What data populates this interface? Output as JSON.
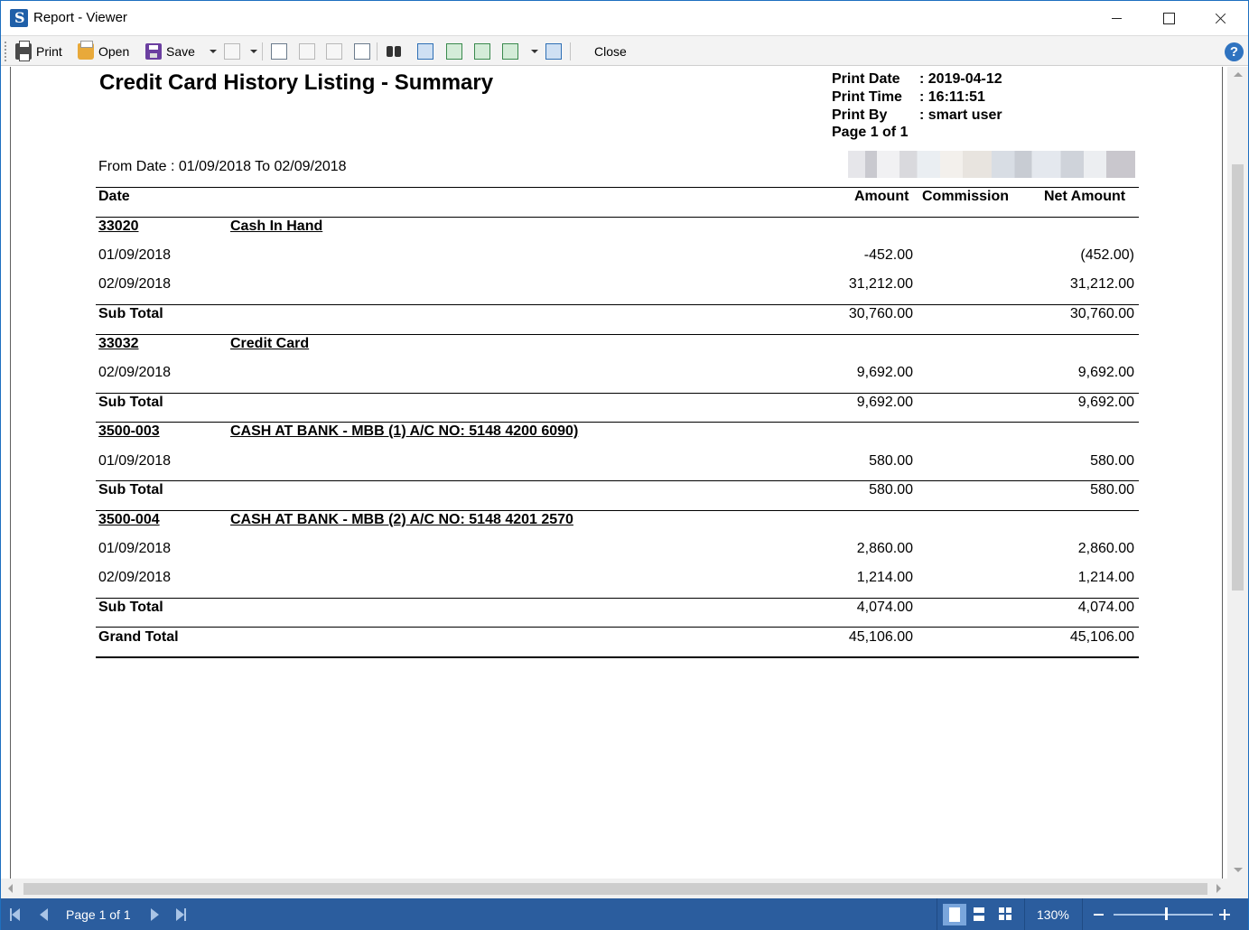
{
  "window": {
    "title": "Report - Viewer"
  },
  "toolbar": {
    "print_label": "Print",
    "open_label": "Open",
    "save_label": "Save",
    "close_label": "Close",
    "help_label": "?"
  },
  "report": {
    "title": "Credit Card History Listing - Summary",
    "meta": {
      "print_date_label": "Print Date",
      "print_date_value": ": 2019-04-12",
      "print_time_label": "Print Time",
      "print_time_value": ": 16:11:51",
      "print_by_label": "Print By",
      "print_by_value": ": smart user",
      "page_label": "Page 1 of 1"
    },
    "date_range": "From Date : 01/09/2018 To 02/09/2018",
    "columns": {
      "date": "Date",
      "amount": "Amount",
      "commission": "Commission",
      "net_amount": "Net Amount"
    },
    "groups": [
      {
        "code": "33020",
        "name": "Cash In Hand",
        "rows": [
          {
            "date": "01/09/2018",
            "amount": "-452.00",
            "net": "(452.00)"
          },
          {
            "date": "02/09/2018",
            "amount": "31,212.00",
            "net": "31,212.00"
          }
        ],
        "subtotal_label": "Sub Total",
        "subtotal_amount": "30,760.00",
        "subtotal_net": "30,760.00"
      },
      {
        "code": "33032",
        "name": "Credit Card",
        "rows": [
          {
            "date": "02/09/2018",
            "amount": "9,692.00",
            "net": "9,692.00"
          }
        ],
        "subtotal_label": "Sub Total",
        "subtotal_amount": "9,692.00",
        "subtotal_net": "9,692.00"
      },
      {
        "code": "3500-003",
        "name": "CASH AT BANK - MBB (1) A/C NO: 5148 4200 6090)",
        "rows": [
          {
            "date": "01/09/2018",
            "amount": "580.00",
            "net": "580.00"
          }
        ],
        "subtotal_label": "Sub Total",
        "subtotal_amount": "580.00",
        "subtotal_net": "580.00"
      },
      {
        "code": "3500-004",
        "name": "CASH AT BANK - MBB (2) A/C NO: 5148 4201 2570",
        "rows": [
          {
            "date": "01/09/2018",
            "amount": "2,860.00",
            "net": "2,860.00"
          },
          {
            "date": "02/09/2018",
            "amount": "1,214.00",
            "net": "1,214.00"
          }
        ],
        "subtotal_label": "Sub Total",
        "subtotal_amount": "4,074.00",
        "subtotal_net": "4,074.00"
      }
    ],
    "grand_total_label": "Grand Total",
    "grand_total_amount": "45,106.00",
    "grand_total_net": "45,106.00"
  },
  "statusbar": {
    "page_indicator": "Page 1 of 1",
    "zoom": "130%"
  },
  "colors": {
    "statusbar_bg": "#2b5d9e",
    "window_border": "#1e6fc0",
    "help_icon": "#2f73c0"
  }
}
